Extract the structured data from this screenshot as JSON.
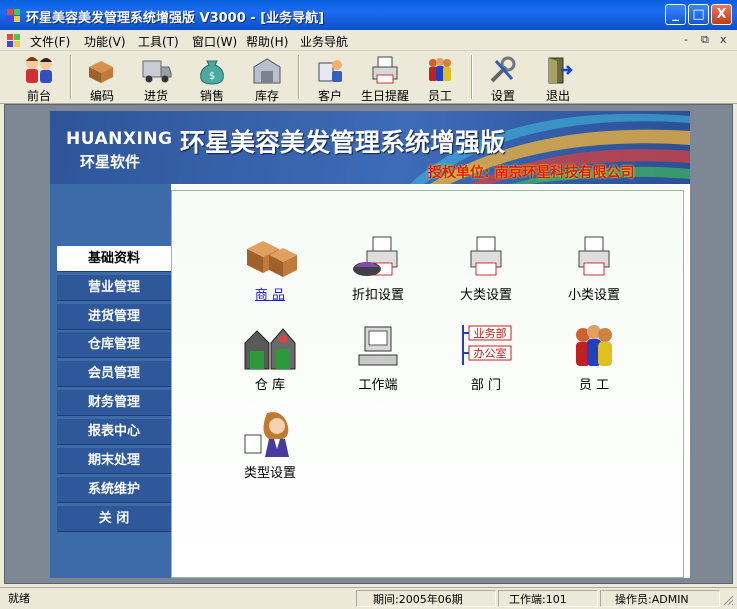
{
  "window": {
    "title": "环星美容美发管理系统增强版  V3000 - [业务导航]",
    "controls": {
      "minimize": "_",
      "maximize": "□",
      "close": "X"
    }
  },
  "menu": {
    "items": [
      "文件(F)",
      "功能(V)",
      "工具(T)",
      "窗口(W)",
      "帮助(H)",
      "业务导航"
    ],
    "mdi_controls": [
      "-",
      "⧉",
      "x"
    ]
  },
  "toolbar": {
    "buttons": [
      {
        "label": "前台",
        "icon": "people-icon"
      },
      {
        "label": "编码",
        "icon": "boxes-icon"
      },
      {
        "label": "进货",
        "icon": "truck-icon"
      },
      {
        "label": "销售",
        "icon": "money-bag-icon"
      },
      {
        "label": "库存",
        "icon": "warehouse-icon"
      },
      {
        "label": "客户",
        "icon": "customer-icon"
      },
      {
        "label": "生日提醒",
        "icon": "printer-icon"
      },
      {
        "label": "员工",
        "icon": "staff-icon"
      },
      {
        "label": "设置",
        "icon": "tools-icon"
      },
      {
        "label": "退出",
        "icon": "exit-door-icon"
      }
    ]
  },
  "banner": {
    "brand_en": "HUANXING",
    "brand_cn": "环星软件",
    "title": "环星美容美发管理系统增强版",
    "authorized": "授权单位:  南京环星科技有限公司"
  },
  "sidebar": {
    "items": [
      "基础资料",
      "营业管理",
      "进货管理",
      "仓库管理",
      "会员管理",
      "财务管理",
      "报表中心",
      "期末处理",
      "系统维护",
      "关    闭"
    ],
    "active_index": 0
  },
  "nav_icons": [
    {
      "label": "商    品",
      "icon": "goods-boxes-icon"
    },
    {
      "label": "折扣设置",
      "icon": "discount-printer-icon"
    },
    {
      "label": "大类设置",
      "icon": "category-printer-icon"
    },
    {
      "label": "小类设置",
      "icon": "subcategory-printer-icon"
    },
    {
      "label": "仓    库",
      "icon": "warehouse-building-icon"
    },
    {
      "label": "工作端",
      "icon": "computer-icon"
    },
    {
      "label": "部    门",
      "icon": "department-icon"
    },
    {
      "label": "员    工",
      "icon": "employees-icon"
    },
    {
      "label": "类型设置",
      "icon": "type-girl-icon"
    }
  ],
  "department_tags": [
    "业务部",
    "办公室"
  ],
  "status": {
    "ready": "就绪",
    "period": "期间:2005年06期",
    "terminal": "工作端:101",
    "operator": "操作员:ADMIN"
  },
  "colors": {
    "title_bar": "#0a5fe0",
    "sidebar": "#2e5899",
    "banner": "#3e6bb8",
    "authorized_text": "#e8141a",
    "link": "#1a1adc"
  }
}
